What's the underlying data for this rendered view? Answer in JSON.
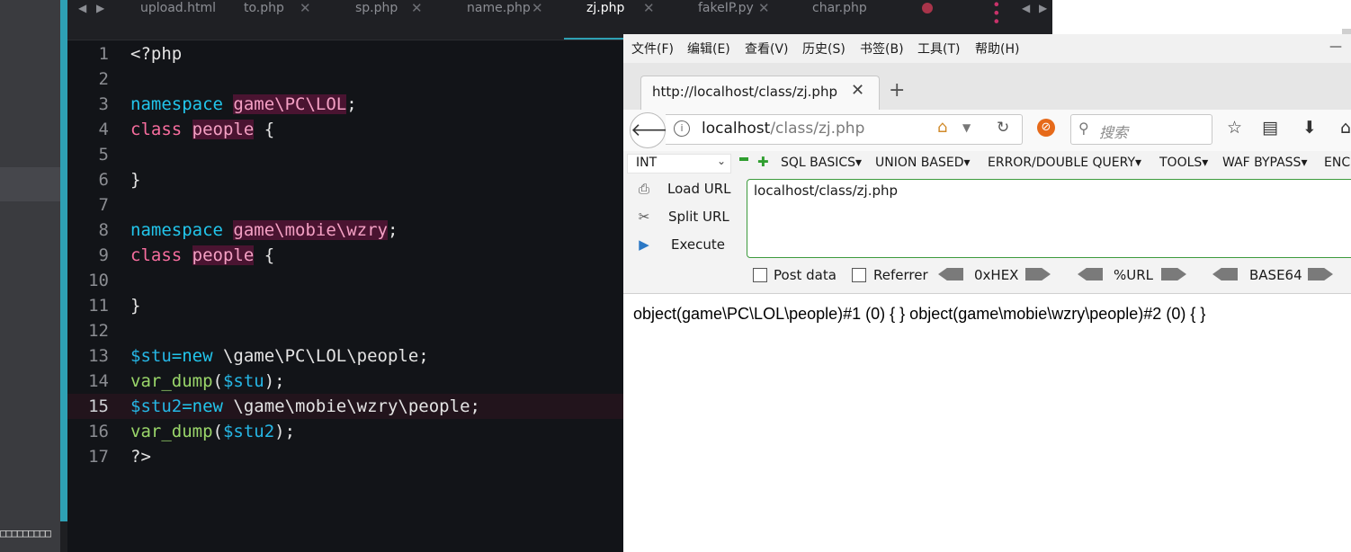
{
  "editor": {
    "tabs": [
      {
        "label": "upload.html",
        "active": false
      },
      {
        "label": "to.php",
        "active": false
      },
      {
        "label": "sp.php",
        "active": false
      },
      {
        "label": "name.php",
        "active": false
      },
      {
        "label": "zj.php",
        "active": true
      },
      {
        "label": "fakeIP.py",
        "active": false
      },
      {
        "label": "char.php",
        "active": false
      }
    ],
    "current_line": 15,
    "line_numbers": [
      "1",
      "2",
      "3",
      "4",
      "5",
      "6",
      "7",
      "8",
      "9",
      "10",
      "11",
      "12",
      "13",
      "14",
      "15",
      "16",
      "17"
    ],
    "code": {
      "l1": "<?php",
      "l3_kw": "namespace",
      "l3_ns": "game\\PC\\LOL",
      "l3_end": ";",
      "l4_kw": "class",
      "l4_name": "people",
      "l4_end": " {",
      "l6": "}",
      "l8_kw": "namespace",
      "l8_ns": "game\\mobie\\wzry",
      "l8_end": ";",
      "l9_kw": "class",
      "l9_name": "people",
      "l9_end": " {",
      "l11": "}",
      "l13_var": "$stu",
      "l13_op": "=new",
      "l13_rest": " \\game\\PC\\LOL\\people;",
      "l14_fn": "var_dump",
      "l14_open": "(",
      "l14_var": "$stu",
      "l14_close": ");",
      "l15_var": "$stu2",
      "l15_op": "=new",
      "l15_rest": " \\game\\mobie\\wzry\\people;",
      "l16_fn": "var_dump",
      "l16_open": "(",
      "l16_var": "$stu2",
      "l16_close": ");",
      "l17": "?>"
    },
    "left_panel_text": "□□□□□□□□□"
  },
  "browser": {
    "menu": [
      "文件(F)",
      "编辑(E)",
      "查看(V)",
      "历史(S)",
      "书签(B)",
      "工具(T)",
      "帮助(H)"
    ],
    "minimize": "—",
    "tab_title": "http://localhost/class/zj.php",
    "tab_close": "✕",
    "new_tab": "+",
    "url_host": "localhost",
    "url_path": "/class/zj.php",
    "search_placeholder": "搜索"
  },
  "hackbar": {
    "select_value": "INT",
    "menus": [
      "SQL BASICS▾",
      "UNION BASED▾",
      "ERROR/DOUBLE QUERY▾",
      "TOOLS▾",
      "WAF BYPASS▾",
      "ENC"
    ],
    "load_url": "Load URL",
    "split_url": "Split URL",
    "execute": "Execute",
    "url_value": "localhost/class/zj.php",
    "post_data": "Post data",
    "referrer": "Referrer",
    "enc_hex": "0xHEX",
    "enc_url": "%URL",
    "enc_base64": "BASE64"
  },
  "output": "object(game\\PC\\LOL\\people)#1 (0) { } object(game\\mobie\\wzry\\people)#2 (0) { }",
  "colors": {
    "accent": "#2ea0b4",
    "keyword_namespace": "#22c6ec",
    "keyword_class": "#f76d9e",
    "function": "#9ad66a",
    "variable": "#26b7e6",
    "hackbar_border": "#3c9a3c"
  }
}
